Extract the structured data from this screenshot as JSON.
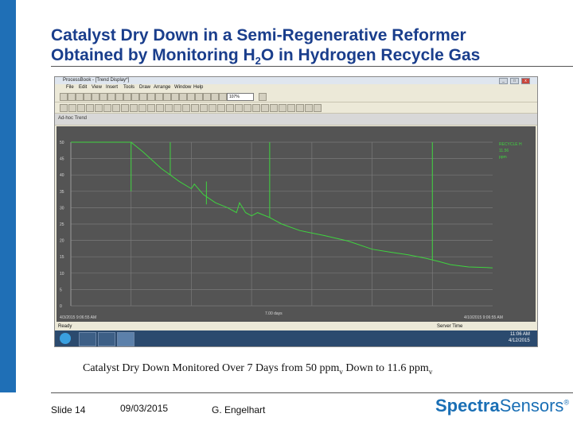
{
  "slide": {
    "title_line1": "Catalyst Dry Down in a Semi-Regenerative Reformer",
    "title_line2_pre": "Obtained by Monitoring H",
    "title_line2_sub": "2",
    "title_line2_post": "O in Hydrogen Recycle Gas",
    "caption_pre": "Catalyst Dry Down Monitored Over 7 Days from 50 ppm",
    "caption_sub1": "v",
    "caption_mid": " Down to 11.6 ppm",
    "caption_sub2": "v",
    "slide_number": "Slide 14",
    "date": "09/03/2015",
    "author": "G. Engelhart",
    "logo_part1": "Spectra",
    "logo_part2": "Sensors",
    "logo_mark": "®"
  },
  "app": {
    "window_title": "ProcessBook - [Trend Display*]",
    "menus": [
      "File",
      "Edit",
      "View",
      "Insert",
      "Tools",
      "Draw",
      "Arrange",
      "Window",
      "Help"
    ],
    "zoom": "107%",
    "trend_label": "Ad-hoc Trend",
    "start_time": "4/3/2015 9:06:55 AM",
    "end_time": "4/10/2015 9:06:55 AM",
    "span": "7.00 days",
    "status_left": "Ready",
    "status_right": "Server Time",
    "clock_time": "11:06 AM",
    "clock_date": "4/12/2015",
    "legend": [
      "RECYCLE H",
      "11.56",
      "ppm"
    ],
    "colors": {
      "trace": "#3fd43f",
      "plot_bg": "#545454",
      "grid": "#7a7a7a",
      "axis_text": "#d8d8d8"
    }
  },
  "chart_data": {
    "type": "line",
    "title": "",
    "xlabel": "",
    "ylabel": "",
    "x_range": [
      "4/3/2015 9:06:55 AM",
      "4/10/2015 9:06:55 AM"
    ],
    "ylim": [
      0,
      50
    ],
    "y_ticks": [
      "0",
      "5",
      "10",
      "15",
      "20",
      "25",
      "30",
      "35",
      "40",
      "45",
      "50"
    ],
    "grid": true,
    "series": [
      {
        "name": "RECYCLE H",
        "x_days": [
          0,
          1.0,
          1.2,
          1.5,
          1.8,
          2.0,
          2.05,
          2.2,
          2.4,
          2.6,
          2.75,
          2.8,
          2.9,
          3.0,
          3.1,
          3.3,
          3.5,
          3.8,
          4.2,
          4.6,
          5.0,
          5.3,
          5.6,
          5.9,
          6.05,
          6.1,
          6.3,
          6.6,
          6.9,
          7.0
        ],
        "values": [
          50,
          50,
          47,
          42,
          38,
          35.8,
          37.2,
          34,
          31.5,
          30,
          28.5,
          31.5,
          28.5,
          27.5,
          28.5,
          27,
          25,
          23,
          21.5,
          19.8,
          17.3,
          16.4,
          15.6,
          14.5,
          13.8,
          13.6,
          12.6,
          11.9,
          11.7,
          11.6
        ]
      }
    ],
    "spikes": [
      {
        "x_days": 1.0,
        "values": [
          50,
          35
        ]
      },
      {
        "x_days": 1.65,
        "values": [
          50,
          40
        ]
      },
      {
        "x_days": 2.25,
        "values": [
          38,
          31
        ]
      },
      {
        "x_days": 3.3,
        "values": [
          50,
          27
        ]
      },
      {
        "x_days": 6.0,
        "values": [
          50,
          14
        ]
      }
    ]
  }
}
